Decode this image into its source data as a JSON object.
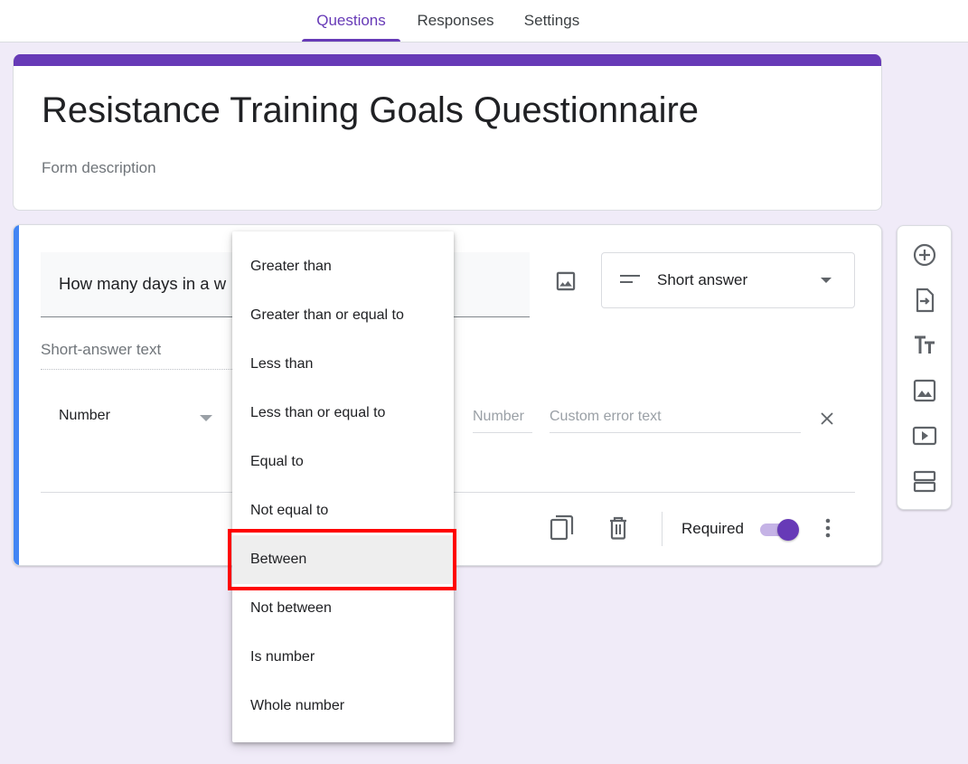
{
  "tabs": [
    {
      "label": "Questions",
      "active": true
    },
    {
      "label": "Responses",
      "active": false
    },
    {
      "label": "Settings",
      "active": false
    }
  ],
  "form": {
    "title": "Resistance Training Goals Questionnaire",
    "description_placeholder": "Form description",
    "accent_color": "#673ab7"
  },
  "question": {
    "title": "How many days in a w",
    "type_label": "Short answer",
    "answer_placeholder": "Short-answer text",
    "validation_type": "Number",
    "number_placeholder": "Number",
    "error_placeholder": "Custom error text",
    "required_label": "Required",
    "required_on": true
  },
  "validation_menu": {
    "items": [
      "Greater than",
      "Greater than or equal to",
      "Less than",
      "Less than or equal to",
      "Equal to",
      "Not equal to",
      "Between",
      "Not between",
      "Is number",
      "Whole number"
    ],
    "selected": "Between"
  },
  "side_toolbar": [
    "add-question-icon",
    "import-questions-icon",
    "add-title-icon",
    "add-image-icon",
    "add-video-icon",
    "add-section-icon"
  ]
}
